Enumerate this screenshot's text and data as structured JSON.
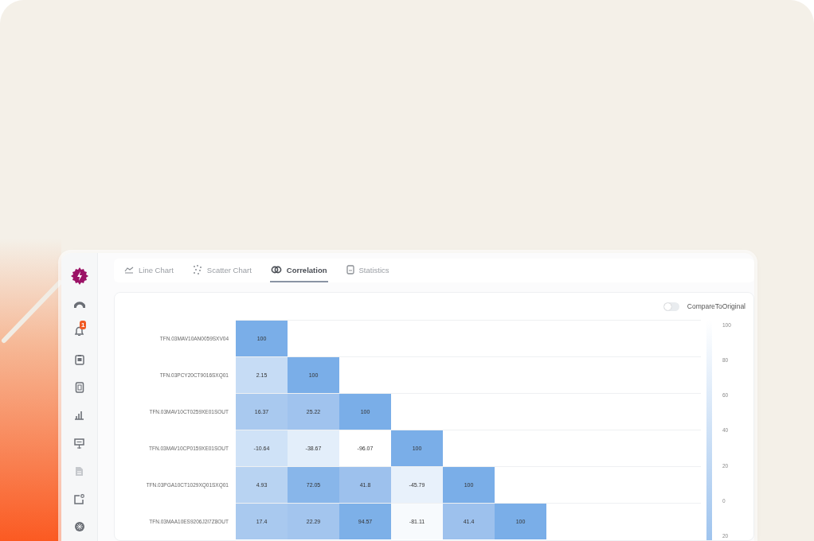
{
  "sidebar": {
    "notification_badge": "1"
  },
  "tabs": [
    {
      "label": "Line Chart",
      "selected": false
    },
    {
      "label": "Scatter Chart",
      "selected": false
    },
    {
      "label": "Correlation",
      "selected": true
    },
    {
      "label": "Statistics",
      "selected": false
    }
  ],
  "toggle": {
    "label": "CompareToOriginal",
    "on": false
  },
  "heatmap": {
    "rows": [
      {
        "label": "TFN.03MAV10AN0059SXV04",
        "cells": [
          {
            "value": "100",
            "color": "#7aaee8"
          }
        ]
      },
      {
        "label": "TFN.03PCY20CT9016SXQ01",
        "cells": [
          {
            "value": "2.15",
            "color": "#c6dcf5"
          },
          {
            "value": "100",
            "color": "#7aaee8"
          }
        ]
      },
      {
        "label": "TFN.03MAV10CT0259XE01SOUT",
        "cells": [
          {
            "value": "16.37",
            "color": "#a9c9ef"
          },
          {
            "value": "25.22",
            "color": "#a0c3ee"
          },
          {
            "value": "100",
            "color": "#7aaee8"
          }
        ]
      },
      {
        "label": "TFN.03MAV10CP0159XE01SOUT",
        "cells": [
          {
            "value": "-10.64",
            "color": "#cfe2f7"
          },
          {
            "value": "-38.67",
            "color": "#e3eefa"
          },
          {
            "value": "-96.07",
            "color": "#ffffff"
          },
          {
            "value": "100",
            "color": "#7aaee8"
          }
        ]
      },
      {
        "label": "TFN.03PGA10CT1029XQ01SXQ01",
        "cells": [
          {
            "value": "4.93",
            "color": "#b8d3f2"
          },
          {
            "value": "72.05",
            "color": "#88b6ea"
          },
          {
            "value": "41.8",
            "color": "#9dc1ed"
          },
          {
            "value": "-45.79",
            "color": "#e8f1fb"
          },
          {
            "value": "100",
            "color": "#7aaee8"
          }
        ]
      },
      {
        "label": "TFN.03MAA10ES9206J2I7Z8OUT",
        "cells": [
          {
            "value": "17.4",
            "color": "#a9c9ef"
          },
          {
            "value": "22.29",
            "color": "#a3c5ee"
          },
          {
            "value": "94.57",
            "color": "#7db0e8"
          },
          {
            "value": "-81.11",
            "color": "#f7fafd"
          },
          {
            "value": "41.4",
            "color": "#9dc1ed"
          },
          {
            "value": "100",
            "color": "#7aaee8"
          }
        ]
      }
    ],
    "scale": [
      "100",
      "80",
      "60",
      "40",
      "20",
      "0",
      "20"
    ]
  }
}
